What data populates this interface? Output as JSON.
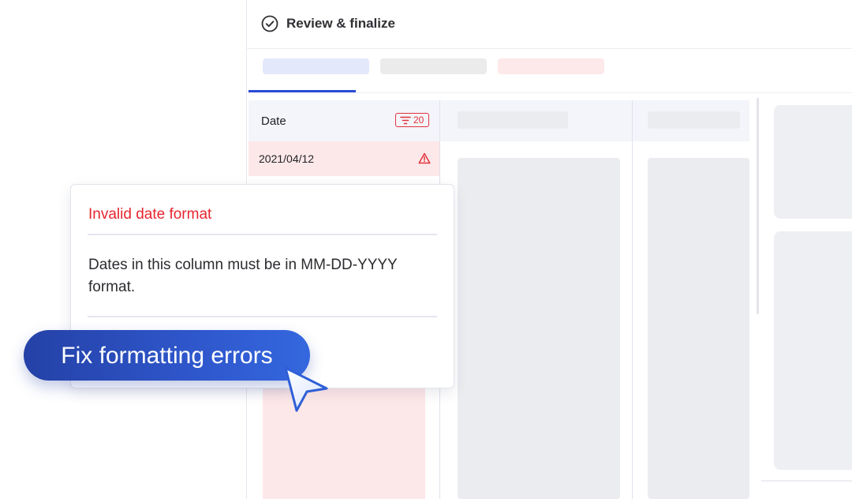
{
  "header": {
    "title": "Review & finalize",
    "icon": "check-circle-icon"
  },
  "tabs": [
    {
      "state": "active",
      "color": "#e4e8fb"
    },
    {
      "state": "inactive",
      "color": "#ebebeb"
    },
    {
      "state": "error",
      "color": "#fde8ea"
    }
  ],
  "table": {
    "date_column": {
      "header": "Date",
      "filter_count": "20",
      "rows": [
        {
          "value": "2021/04/12",
          "status": "error"
        }
      ]
    }
  },
  "popover": {
    "title": "Invalid date format",
    "message": "Dates in this column must be in MM-DD-YYYY format."
  },
  "cta": {
    "label": "Fix formatting errors"
  },
  "colors": {
    "accent": "#2b4cd6",
    "error": "#e0323c",
    "error_bg": "#fde8e9",
    "cta": "#2b4fc2"
  }
}
